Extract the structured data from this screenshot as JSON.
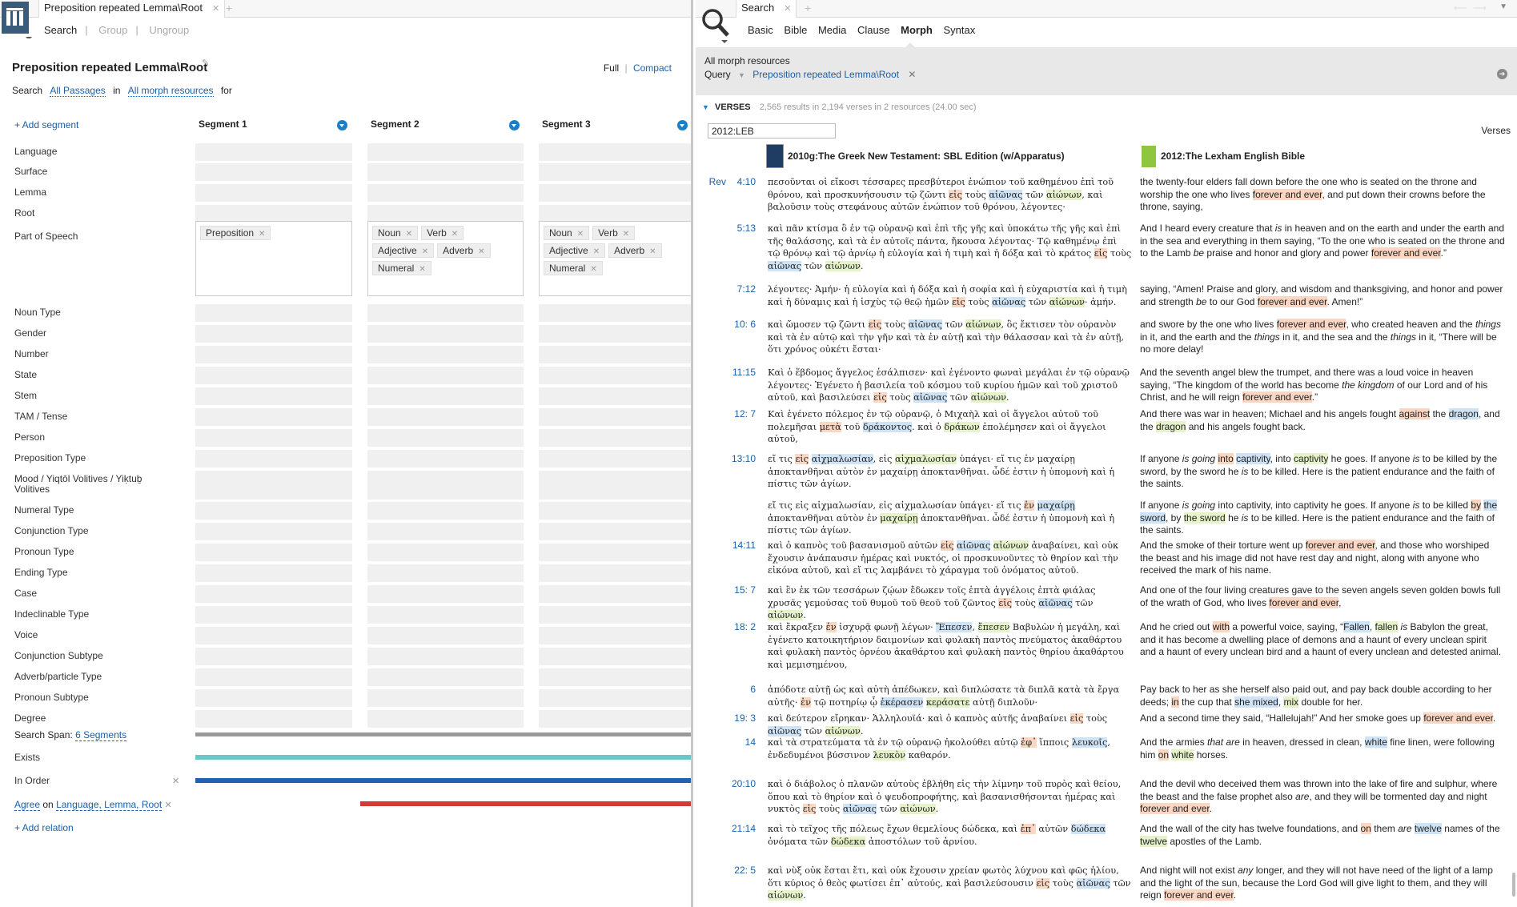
{
  "left": {
    "tab_title": "Preposition repeated Lemma\\Root",
    "toolbar": [
      "Search",
      "Group",
      "Ungroup"
    ],
    "title": "Preposition repeated Lemma\\Root",
    "view_full": "Full",
    "view_compact": "Compact",
    "search_prefix": "Search",
    "passages": "All Passages",
    "in_word": "in",
    "resources": "All morph resources",
    "for_word": "for",
    "add_segment": "+ Add segment",
    "segments": [
      "Segment 1",
      "Segment 2",
      "Segment 3"
    ],
    "rows": [
      "Language",
      "Surface",
      "Lemma",
      "Root",
      "Part of Speech",
      "Noun Type",
      "Gender",
      "Number",
      "State",
      "Stem",
      "TAM / Tense",
      "Person",
      "Preposition Type",
      "Mood / Yiqtōl Volitives / Yiḳtuḇ Volitives",
      "Numeral Type",
      "Conjunction Type",
      "Pronoun Type",
      "Ending Type",
      "Case",
      "Indeclinable Type",
      "Voice",
      "Conjunction Subtype",
      "Adverb/particle Type",
      "Pronoun Subtype",
      "Degree"
    ],
    "pos_seg1": [
      "Preposition"
    ],
    "pos_seg2": [
      "Noun",
      "Verb",
      "Adjective",
      "Adverb",
      "Numeral"
    ],
    "pos_seg3": [
      "Noun",
      "Verb",
      "Adjective",
      "Adverb",
      "Numeral"
    ],
    "search_span_label": "Search Span:",
    "search_span_value": "6 Segments",
    "exists": "Exists",
    "in_order": "In Order",
    "agree": "Agree",
    "agree_on": "on",
    "agree_fields": "Language, Lemma, Root",
    "add_relation": "+ Add relation",
    "colors": {
      "exists": "#6ac7c9",
      "in_order": "#1f63b0",
      "agree": "#d33a36",
      "span": "#9a9a9a"
    }
  },
  "right": {
    "tab_title": "Search",
    "toolbar": [
      "Basic",
      "Bible",
      "Media",
      "Clause",
      "Morph",
      "Syntax"
    ],
    "scope": "All morph resources",
    "query_label": "Query",
    "query_value": "Preposition repeated Lemma\\Root",
    "section": "VERSES",
    "results": "2,565 results in 2,194 verses in 2 resources (24.00 sec)",
    "filter_value": "2012:LEB",
    "view_mode": "Verses",
    "col1": "2010g:The Greek New Testament: SBL Edition (w/Apparatus)",
    "col2": "2012:The Lexham English Bible",
    "book": "Rev",
    "verses": [
      {
        "ref": "4:10",
        "gk": "πεσοῦνται οἱ εἴκοσι τέσσαρες πρεσβύτεροι ἐνώπιον τοῦ καθημένου ἐπὶ τοῦ θρόνου, καὶ προσκυνήσουσιν τῷ ζῶντι <span class=o>εἰς</span> τοὺς <span class=b>αἰῶνας</span> τῶν <span class=g>αἰώνων</span>, καὶ βαλοῦσιν τοὺς στεφάνους αὐτῶν ἐνώπιον τοῦ θρόνου, λέγοντες·",
        "en": "the twenty-four elders fall down before the one who is seated on the throne and worship the one who lives <span class=o>forever and ever</span>, and put down their crowns before the throne, saying,"
      },
      {
        "ref": "5:13",
        "gk": "καὶ πᾶν κτίσμα ὃ ἐν τῷ οὐρανῷ καὶ ἐπὶ τῆς γῆς καὶ ὑποκάτω τῆς γῆς καὶ ἐπὶ τῆς θαλάσσης, καὶ τὰ ἐν αὐτοῖς πάντα, ἤκουσα λέγοντας· Τῷ καθημένῳ ἐπὶ τῷ θρόνῳ καὶ τῷ ἀρνίῳ ἡ εὐλογία καὶ ἡ τιμὴ καὶ ἡ δόξα καὶ τὸ κράτος <span class=o>εἰς</span> τοὺς <span class=b>αἰῶνας</span> τῶν <span class=g>αἰώνων</span>.",
        "en": "And I heard every creature that <i>is</i> in heaven and on the earth and under the earth and in the sea and everything in them saying, “To the one who is seated on the throne and to the Lamb <i>be</i> praise and honor and glory and power <span class=o>forever and ever</span>.”"
      },
      {
        "ref": "7:12",
        "gk": "λέγοντες· Ἀμήν· ἡ εὐλογία καὶ ἡ δόξα καὶ ἡ σοφία καὶ ἡ εὐχαριστία καὶ ἡ τιμὴ καὶ ἡ δύναμις καὶ ἡ ἰσχὺς τῷ θεῷ ἡμῶν <span class=o>εἰς</span> τοὺς <span class=b>αἰῶνας</span> τῶν <span class=g>αἰώνων</span>· ἀμήν.",
        "en": "saying, “Amen! Praise and glory, and wisdom and thanksgiving, and honor and power and strength <i>be</i> to our God <span class=o>forever and ever</span>. Amen!”"
      },
      {
        "ref": "10: 6",
        "gk": "καὶ ὤμοσεν τῷ ζῶντι <span class=o>εἰς</span> τοὺς <span class=b>αἰῶνας</span> τῶν <span class=g>αἰώνων</span>, ὃς ἔκτισεν τὸν οὐρανὸν καὶ τὰ ἐν αὐτῷ καὶ τὴν γῆν καὶ τὰ ἐν αὐτῇ καὶ τὴν θάλασσαν καὶ τὰ ἐν αὐτῇ, ὅτι χρόνος οὐκέτι ἔσται·",
        "en": "and swore by the one who lives <span class=o>forever and ever</span>, who created heaven and the <i>things</i> in it, and the earth and the <i>things</i> in it, and the sea and the <i>things</i> in it, “There will be no more delay!"
      },
      {
        "ref": "11:15",
        "gk": "Καὶ ὁ ἕβδομος ἄγγελος ἐσάλπισεν· καὶ ἐγένοντο φωναὶ μεγάλαι ἐν τῷ οὐρανῷ λέγοντες· Ἐγένετο ἡ βασιλεία τοῦ κόσμου τοῦ κυρίου ἡμῶν καὶ τοῦ χριστοῦ αὐτοῦ, καὶ βασιλεύσει <span class=o>εἰς</span> τοὺς <span class=b>αἰῶνας</span> τῶν <span class=g>αἰώνων</span>.",
        "en": "And the seventh angel blew the trumpet, and there was a loud voice in heaven saying, “The kingdom of the world has become <i>the kingdom</i> of our Lord and of his Christ, and he will reign <span class=o>forever and ever</span>.”"
      },
      {
        "ref": "12: 7",
        "gk": "Καὶ ἐγένετο πόλεμος ἐν τῷ οὐρανῷ, ὁ Μιχαὴλ καὶ οἱ ἄγγελοι αὐτοῦ τοῦ πολεμῆσαι <span class=o>μετὰ</span> τοῦ <span class=b>δράκοντος</span>. καὶ ὁ <span class=g>δράκων</span> ἐπολέμησεν καὶ οἱ ἄγγελοι αὐτοῦ,",
        "en": "And there was war in heaven; Michael and his angels fought <span class=o>against</span> the <span class=b>dragon</span>, and the <span class=g>dragon</span> and his angels fought back."
      },
      {
        "ref": "13:10",
        "gk": "εἴ τις <span class=o>εἰς</span> <span class=b>αἰχμαλωσίαν</span>, εἰς <span class=g>αἰχμαλωσίαν</span> ὑπάγει· εἴ τις ἐν μαχαίρῃ ἀποκτανθῆναι αὐτὸν ἐν μαχαίρῃ ἀποκτανθῆναι. ὧδέ ἐστιν ἡ ὑπομονὴ καὶ ἡ πίστις τῶν ἁγίων.",
        "en": "If anyone <i>is going</i> <span class=o>into</span> <span class=b>captivity</span>, into <span class=g>captivity</span> he goes. If anyone <i>is</i> to be killed by the sword, by the sword he <i>is</i> to be killed. Here is the patient endurance and the faith of the saints."
      },
      {
        "ref": "",
        "gk": "εἴ τις εἰς αἰχμαλωσίαν, εἰς αἰχμαλωσίαν ὑπάγει· εἴ τις <span class=o>ἐν</span> <span class=b>μαχαίρῃ</span> ἀποκτανθῆναι αὐτὸν ἐν <span class=g>μαχαίρῃ</span> ἀποκτανθῆναι. ὧδέ ἐστιν ἡ ὑπομονὴ καὶ ἡ πίστις τῶν ἁγίων.",
        "en": "If anyone <i>is going</i> into captivity, into captivity he goes. If anyone <i>is</i> to be killed <span class=o>by</span> <span class=b>the sword</span>, by <span class=g>the sword</span> he <i>is</i> to be killed. Here is the patient endurance and the faith of the saints."
      },
      {
        "ref": "14:11",
        "gk": "καὶ ὁ καπνὸς τοῦ βασανισμοῦ αὐτῶν <span class=o>εἰς</span> <span class=b>αἰῶνας</span> <span class=g>αἰώνων</span> ἀναβαίνει, καὶ οὐκ ἔχουσιν ἀνάπαυσιν ἡμέρας καὶ νυκτός, οἱ προσκυνοῦντες τὸ θηρίον καὶ τὴν εἰκόνα αὐτοῦ, καὶ εἴ τις λαμβάνει τὸ χάραγμα τοῦ ὀνόματος αὐτοῦ.",
        "en": "And the smoke of their torture went up <span class=o>forever and ever</span>, and those who worshiped the beast and his image did not have rest day and night, along with anyone who received the mark of his name."
      },
      {
        "ref": "15: 7",
        "gk": "καὶ ἓν ἐκ τῶν τεσσάρων ζῴων ἔδωκεν τοῖς ἑπτὰ ἀγγέλοις ἑπτὰ φιάλας χρυσᾶς γεμούσας τοῦ θυμοῦ τοῦ θεοῦ τοῦ ζῶντος <span class=o>εἰς</span> τοὺς <span class=b>αἰῶνας</span> τῶν <span class=g>αἰώνων</span>.",
        "en": "And one of the four living creatures gave to the seven angels seven golden bowls full of the wrath of God, who lives <span class=o>forever and ever</span>,"
      },
      {
        "ref": "18: 2",
        "gk": "καὶ ἔκραξεν <span class=o>ἐν</span> ἰσχυρᾷ φωνῇ λέγων· <span class=b>Ἔπεσεν</span>, <span class=g>ἔπεσεν</span> Βαβυλὼν ἡ μεγάλη, καὶ ἐγένετο κατοικητήριον δαιμονίων καὶ φυλακὴ παντὸς πνεύματος ἀκαθάρτου καὶ φυλακὴ παντὸς ὀρνέου ἀκαθάρτου καὶ φυλακὴ παντὸς θηρίου ἀκαθάρτου καὶ μεμισημένου,",
        "en": "And he cried out <span class=o>with</span> a powerful voice, saying, “<span class=b>Fallen</span>, <span class=g>fallen</span> <i>is</i> Babylon the great, and it has become a dwelling place of demons and a haunt of every unclean spirit and a haunt of every unclean bird and a haunt of every unclean and detested animal."
      },
      {
        "ref": "6",
        "gk": "ἀπόδοτε αὐτῇ ὡς καὶ αὐτὴ ἀπέδωκεν, καὶ διπλώσατε τὰ διπλᾶ κατὰ τὰ ἔργα αὐτῆς· <span class=o>ἐν</span> τῷ ποτηρίῳ ᾧ <span class=b>ἐκέρασεν</span> <span class=g>κεράσατε</span> αὐτῇ διπλοῦν·",
        "en": "Pay back to her as she herself also paid out, and pay back double according to her deeds; <span class=o>in</span> the cup that <span class=b>she mixed</span>, <span class=g>mix</span> double for her."
      },
      {
        "ref": "19: 3",
        "gk": "καὶ δεύτερον εἴρηκαν· Ἁλληλουϊά· καὶ ὁ καπνὸς αὐτῆς ἀναβαίνει <span class=o>εἰς</span> τοὺς <span class=b>αἰῶνας</span> τῶν <span class=g>αἰώνων</span>.",
        "en": "And a second time they said, “Hallelujah!” And her smoke goes up <span class=o>forever and ever</span>."
      },
      {
        "ref": "14",
        "gk": "καὶ τὰ στρατεύματα τὰ ἐν τῷ οὐρανῷ ἠκολούθει αὐτῷ <span class=o>ἐφ᾽</span> ἵπποις <span class=b>λευκοῖς</span>, ἐνδεδυμένοι βύσσινον <span class=g>λευκὸν</span> καθαρόν.",
        "en": "And the armies <i>that are</i> in heaven, dressed in clean, <span class=b>white</span> fine linen, were following him <span class=o>on</span> <span class=g>white</span> horses."
      },
      {
        "ref": "20:10",
        "gk": "καὶ ὁ διάβολος ὁ πλανῶν αὐτοὺς ἐβλήθη εἰς τὴν λίμνην τοῦ πυρὸς καὶ θείου, ὅπου καὶ τὸ θηρίον καὶ ὁ ψευδοπροφήτης, καὶ βασανισθήσονται ἡμέρας καὶ νυκτὸς <span class=o>εἰς</span> τοὺς <span class=b>αἰῶνας</span> τῶν <span class=g>αἰώνων</span>.",
        "en": "And the devil who deceived them was thrown into the lake of fire and sulphur, where the beast and the false prophet also <i>are</i>, and they will be tormented day and night <span class=o>forever and ever</span>."
      },
      {
        "ref": "21:14",
        "gk": "καὶ τὸ τεῖχος τῆς πόλεως ἔχων θεμελίους δώδεκα, καὶ <span class=o>ἐπ᾽</span> αὐτῶν <span class=b>δώδεκα</span> ὀνόματα τῶν <span class=g>δώδεκα</span> ἀποστόλων τοῦ ἀρνίου.",
        "en": "And the wall of the city has twelve foundations, and <span class=o>on</span> them <i>are</i> <span class=b>twelve</span> names of the <span class=g>twelve</span> apostles of the Lamb."
      },
      {
        "ref": "22: 5",
        "gk": "καὶ νὺξ οὐκ ἔσται ἔτι, καὶ οὐκ ἔχουσιν χρείαν φωτὸς λύχνου καὶ φῶς ἡλίου, ὅτι κύριος ὁ θεὸς φωτίσει ἐπ᾽ αὐτούς, καὶ βασιλεύσουσιν <span class=o>εἰς</span> τοὺς <span class=b>αἰῶνας</span> τῶν <span class=g>αἰώνων</span>.",
        "en": "And night will not exist <i>any</i> longer, and they will not have need of the light of a lamp and the light of the sun, because the Lord God will give light to them, and they will reign <span class=o>forever and ever</span>."
      }
    ]
  }
}
